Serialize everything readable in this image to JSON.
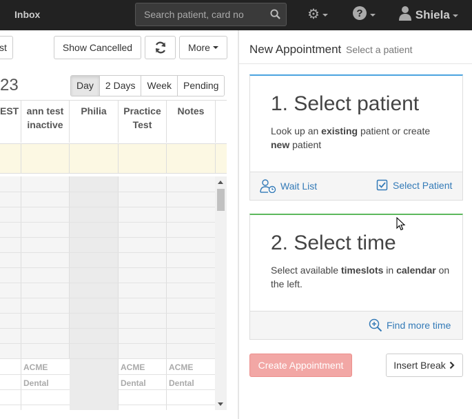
{
  "topbar": {
    "inbox_label": "Inbox",
    "search_placeholder": "Search patient, card no",
    "user_name": "Shiela"
  },
  "toolbar": {
    "partial_button": "st",
    "show_cancelled": "Show Cancelled",
    "more": "More"
  },
  "calendar": {
    "date_partial": "23",
    "views": [
      "Day",
      "2 Days",
      "Week",
      "Pending"
    ],
    "active_view": "Day",
    "columns": [
      {
        "line1": "EST",
        "line2": ""
      },
      {
        "line1": "ann test",
        "line2": "inactive"
      },
      {
        "line1": "Philia",
        "line2": ""
      },
      {
        "line1": "Practice",
        "line2": "Test"
      },
      {
        "line1": "Notes",
        "line2": ""
      }
    ],
    "row_labels": {
      "acme": "ACME",
      "dental": "Dental"
    }
  },
  "panel": {
    "title": "New Appointment",
    "subtitle": "Select a patient",
    "step1": {
      "heading": "1. Select patient",
      "desc_a": "Look up an ",
      "desc_b": "existing",
      "desc_c": " patient or create ",
      "desc_d": "new",
      "desc_e": " patient",
      "wait_list": "Wait List",
      "select_patient": "Select Patient"
    },
    "step2": {
      "heading": "2. Select time",
      "desc_a": "Select available ",
      "desc_b": "timeslots",
      "desc_c": " in ",
      "desc_d": "calendar",
      "desc_e": " on the left.",
      "find_more": "Find more time"
    },
    "create_button": "Create Appointment",
    "insert_break": "Insert Break"
  },
  "colors": {
    "topbar": "#222222",
    "step1_accent": "#4aa3df",
    "step2_accent": "#5cb85c",
    "link": "#337ab7",
    "create_disabled": "#f2a7a5",
    "highlight_row": "#fcf8e3"
  }
}
